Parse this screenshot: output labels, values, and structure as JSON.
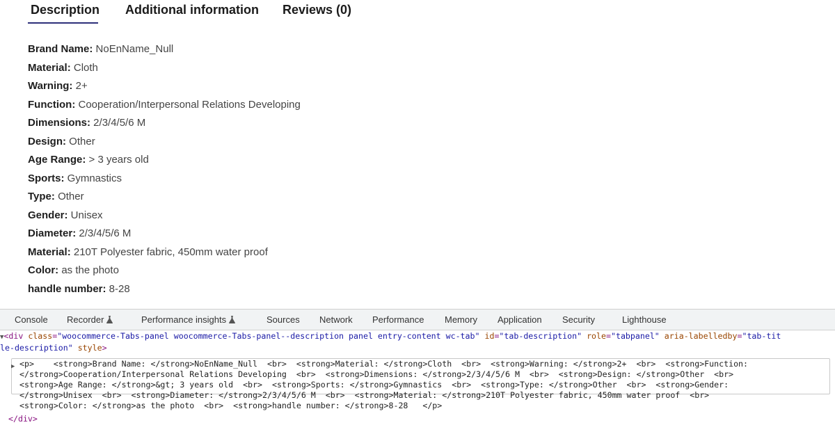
{
  "product_tabs": [
    {
      "label": "Description"
    },
    {
      "label": "Additional information"
    },
    {
      "label": "Reviews (0)"
    }
  ],
  "description": [
    {
      "key": "Brand Name:",
      "value": " NoEnName_Null"
    },
    {
      "key": "Material:",
      "value": " Cloth"
    },
    {
      "key": "Warning:",
      "value": " 2+"
    },
    {
      "key": "Function:",
      "value": " Cooperation/Interpersonal Relations Developing"
    },
    {
      "key": "Dimensions:",
      "value": " 2/3/4/5/6 M"
    },
    {
      "key": "Design:",
      "value": " Other"
    },
    {
      "key": "Age Range:",
      "value": " > 3 years old"
    },
    {
      "key": "Sports:",
      "value": " Gymnastics"
    },
    {
      "key": "Type:",
      "value": " Other"
    },
    {
      "key": "Gender:",
      "value": " Unisex"
    },
    {
      "key": "Diameter:",
      "value": " 2/3/4/5/6 M"
    },
    {
      "key": "Material:",
      "value": " 210T Polyester fabric, 450mm water proof"
    },
    {
      "key": "Color:",
      "value": " as the photo"
    },
    {
      "key": "handle number:",
      "value": " 8-28"
    }
  ],
  "devtools": {
    "tabs": [
      {
        "label": "Console"
      },
      {
        "label": "Recorder"
      },
      {
        "label": "Performance insights"
      },
      {
        "label": "Sources"
      },
      {
        "label": "Network"
      },
      {
        "label": "Performance"
      },
      {
        "label": "Memory"
      },
      {
        "label": "Application"
      },
      {
        "label": "Security"
      },
      {
        "label": "Lighthouse"
      }
    ],
    "flask_icon": "flask-icon",
    "code": {
      "div_open_1": "<div",
      "attr_class": "class",
      "val_class": "\"woocommerce-Tabs-panel woocommerce-Tabs-panel--description panel entry-content wc-tab\"",
      "attr_id": "id",
      "val_id": "\"tab-description\"",
      "attr_role": "role",
      "val_role": "\"tabpanel\"",
      "attr_aria": "aria-labelledby",
      "val_aria_1": "\"tab-tit",
      "val_aria_2": "le-description\"",
      "attr_style": "style",
      "p_line_1": "<p>    <strong>Brand Name: </strong>NoEnName_Null  <br>  <strong>Material: </strong>Cloth  <br>  <strong>Warning: </strong>2+  <br>  <strong>Function: ",
      "p_line_2": "</strong>Cooperation/Interpersonal Relations Developing  <br>  <strong>Dimensions: </strong>2/3/4/5/6 M  <br>  <strong>Design: </strong>Other  <br>",
      "p_line_3": "<strong>Age Range: </strong>&gt; 3 years old  <br>  <strong>Sports: </strong>Gymnastics  <br>  <strong>Type: </strong>Other  <br>  <strong>Gender: ",
      "p_line_4": "</strong>Unisex  <br>  <strong>Diameter: </strong>2/3/4/5/6 M  <br>  <strong>Material: </strong>210T Polyester fabric, 450mm water proof  <br>",
      "p_line_5": "<strong>Color: </strong>as the photo  <br>  <strong>handle number: </strong>8-28   </p>",
      "div_close": "</div>"
    }
  }
}
